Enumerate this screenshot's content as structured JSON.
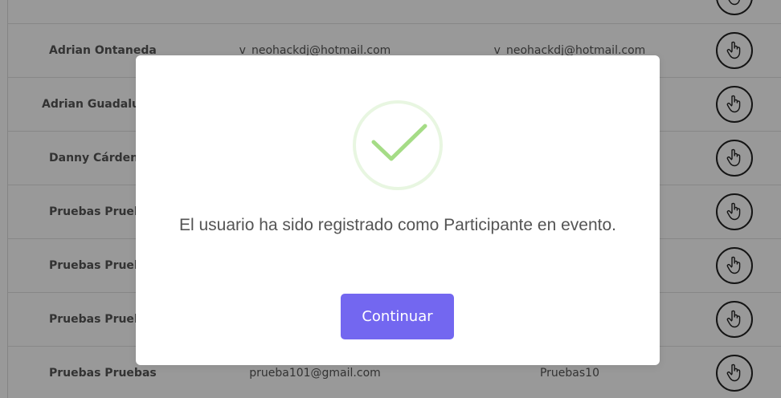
{
  "table": {
    "rows": [
      {
        "name": "",
        "email": "",
        "user": ""
      },
      {
        "name": "Adrian Ontaneda",
        "email": "v_neohackdj@hotmail.com",
        "user": "v_neohackdj@hotmail.com"
      },
      {
        "name": "Adrian Guadalupe",
        "email": "",
        "user": ""
      },
      {
        "name": "Danny Cárdenas",
        "email": "",
        "user": ""
      },
      {
        "name": "Pruebas Pruebas",
        "email": "",
        "user": ""
      },
      {
        "name": "Pruebas Pruebas",
        "email": "",
        "user": ""
      },
      {
        "name": "Pruebas Pruebas",
        "email": "",
        "user": ""
      },
      {
        "name": "Pruebas Pruebas",
        "email": "prueba101@gmail.com",
        "user": "Pruebas10"
      }
    ],
    "action_icon": "hand-pointer-icon"
  },
  "modal": {
    "icon": "success-check-icon",
    "message": "El usuario ha sido registrado como Participante en evento.",
    "continue_label": "Continuar"
  },
  "colors": {
    "accent": "#7367f0",
    "success": "#a5dc86",
    "overlay": "rgba(0,0,0,0.4)"
  }
}
